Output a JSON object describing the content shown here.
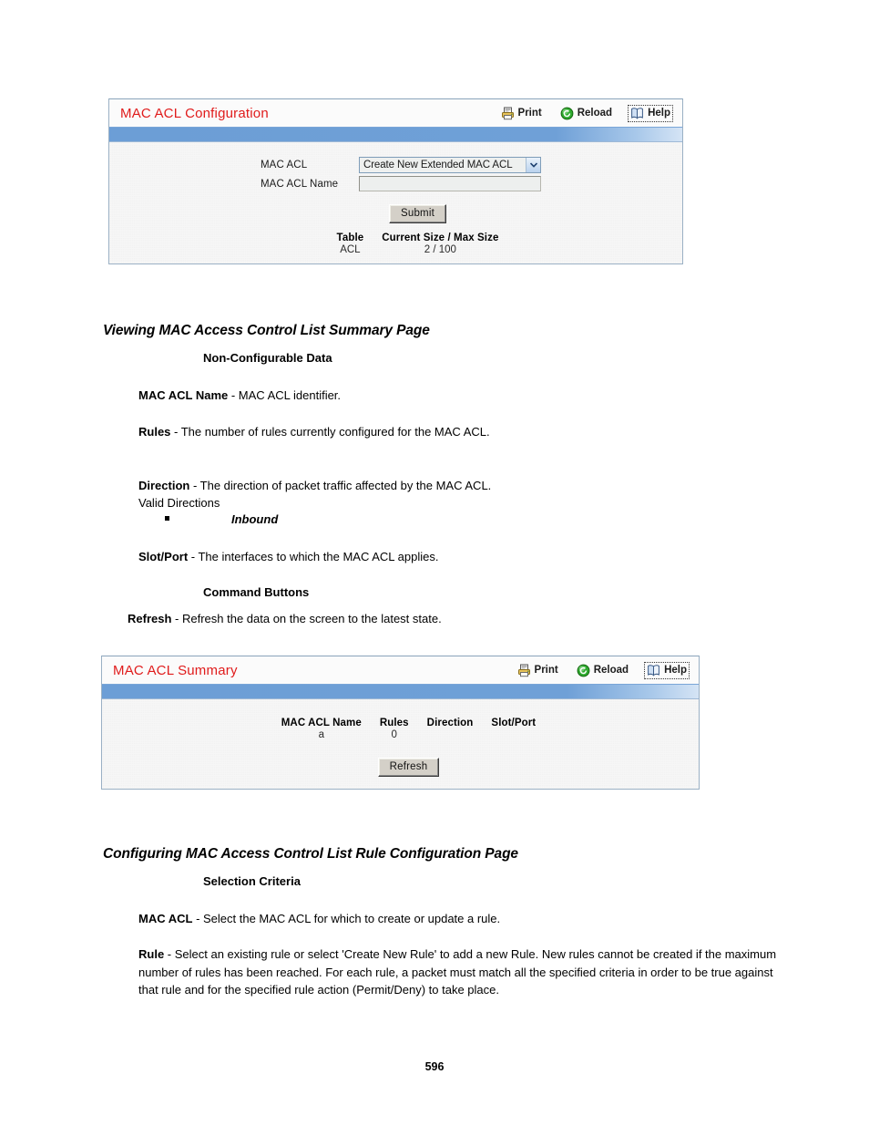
{
  "document": {
    "page_number": "596",
    "sections": [
      {
        "heading": "Viewing MAC Access Control List Summary Page",
        "subheadings": [
          "Non-Configurable Data",
          "Command Buttons"
        ],
        "paragraphs": [
          {
            "term": "MAC ACL Name",
            "text": " - MAC ACL identifier."
          },
          {
            "term": "Rules",
            "text": " - The number of rules currently configured for the MAC ACL."
          },
          {
            "term": "Direction",
            "text": " - The direction of packet traffic affected by the MAC ACL.\nValid Directions"
          },
          {
            "term": "Slot/Port",
            "text": " - The interfaces to which the MAC ACL applies."
          },
          {
            "term": "Refresh",
            "text": " - Refresh the data on the screen to the latest state."
          }
        ],
        "bullets": [
          "Inbound"
        ]
      },
      {
        "heading": "Configuring MAC Access Control List Rule Configuration Page",
        "subheadings": [
          "Selection Criteria"
        ],
        "paragraphs": [
          {
            "term": "MAC ACL",
            "text": " - Select the MAC ACL for which to create or update a rule."
          },
          {
            "term": "Rule",
            "text": " - Select an existing rule or select 'Create New Rule' to add a new Rule. New rules cannot be created if the maximum number of rules has been reached. For each rule, a packet must match all the specified criteria in order to be true against that rule and for the specified rule action (Permit/Deny) to take place."
          }
        ]
      }
    ]
  },
  "colors": {
    "title_red": "#e01b1b",
    "blue_bar": "#6c9ed6",
    "panel_bg": "#f2f2f2",
    "button_face": "#d4d0c8"
  },
  "panel_config": {
    "title": "MAC ACL Configuration",
    "actions": [
      {
        "label": "Print",
        "icon": "printer-icon"
      },
      {
        "label": "Reload",
        "icon": "reload-icon"
      },
      {
        "label": "Help",
        "icon": "help-book-icon"
      }
    ],
    "fields": [
      {
        "label": "MAC ACL",
        "type": "select",
        "value": "Create New Extended MAC ACL"
      },
      {
        "label": "MAC ACL Name",
        "type": "text",
        "value": "",
        "placeholder": ""
      }
    ],
    "submit_label": "Submit",
    "size_table": {
      "headers": [
        "Table",
        "Current Size / Max Size"
      ],
      "rows": [
        [
          "ACL",
          "2 / 100"
        ]
      ]
    }
  },
  "panel_summary": {
    "title": "MAC ACL Summary",
    "actions": [
      {
        "label": "Print",
        "icon": "printer-icon"
      },
      {
        "label": "Reload",
        "icon": "reload-icon"
      },
      {
        "label": "Help",
        "icon": "help-book-icon"
      }
    ],
    "table": {
      "headers": [
        "MAC ACL Name",
        "Rules",
        "Direction",
        "Slot/Port"
      ],
      "rows": [
        [
          "a",
          "0",
          "",
          ""
        ]
      ]
    },
    "refresh_label": "Refresh"
  }
}
